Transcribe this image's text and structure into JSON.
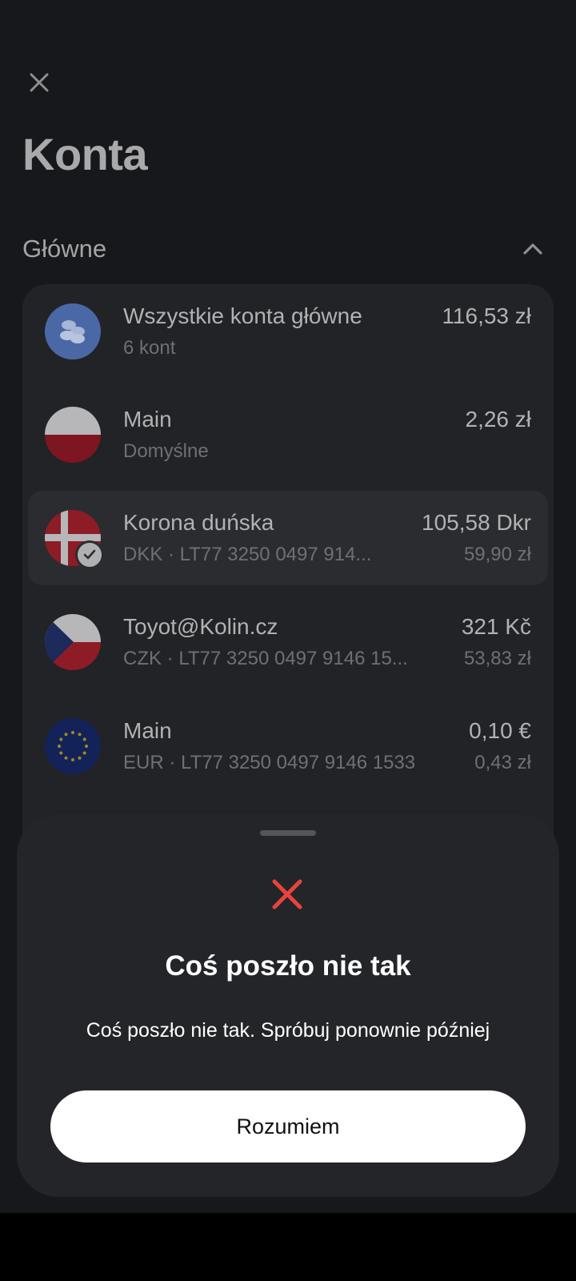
{
  "header": {
    "close_icon": "close-icon",
    "title": "Konta"
  },
  "section": {
    "label": "Główne",
    "toggle_icon": "chevron-up-icon"
  },
  "accounts": [
    {
      "name": "Wszystkie konta główne",
      "sub": "6 kont",
      "amount": "116,53 zł",
      "amount_sub": "",
      "icon": "coins-icon"
    },
    {
      "name": "Main",
      "sub": "Domyślne",
      "amount": "2,26 zł",
      "amount_sub": "",
      "icon": "poland-flag-icon"
    },
    {
      "name": "Korona duńska",
      "sub": "DKK · LT77 3250 0497 914...",
      "amount": "105,58 Dkr",
      "amount_sub": "59,90 zł",
      "icon": "denmark-flag-icon",
      "selected": true
    },
    {
      "name": "Toyot@Kolin.cz",
      "sub": "CZK · LT77 3250 0497 9146 15...",
      "amount": "321 Kč",
      "amount_sub": "53,83 zł",
      "icon": "czech-flag-icon"
    },
    {
      "name": "Main",
      "sub": "EUR · LT77 3250 0497 9146 1533",
      "amount": "0,10 €",
      "amount_sub": "0,43 zł",
      "icon": "eu-flag-icon"
    }
  ],
  "error_sheet": {
    "icon": "error-x-icon",
    "title": "Coś poszło nie tak",
    "message": "Coś poszło nie tak. Spróbuj ponownie później",
    "button_label": "Rozumiem"
  },
  "colors": {
    "background": "#17181b",
    "card": "#222326",
    "sheet": "#242528",
    "error": "#e8433f",
    "button": "#ffffff"
  }
}
